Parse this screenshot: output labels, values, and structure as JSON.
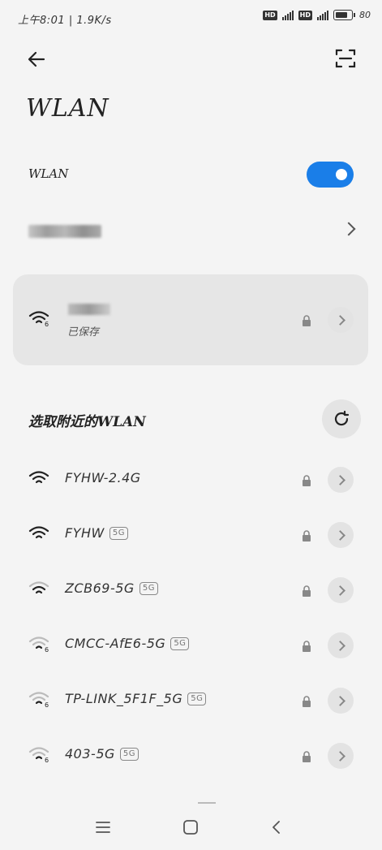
{
  "status_bar": {
    "time_speed": "上午8:01 | 1.9K/s",
    "battery": "80"
  },
  "header": {
    "title": "WLAN"
  },
  "wlan_toggle": {
    "label": "WLAN",
    "on": true
  },
  "saved_network": {
    "status": "已保存"
  },
  "nearby": {
    "title": "选取附近的WLAN",
    "networks": [
      {
        "ssid": "FYHW-2.4G",
        "badge": ""
      },
      {
        "ssid": "FYHW",
        "badge": "5G"
      },
      {
        "ssid": "ZCB69-5G",
        "badge": "5G"
      },
      {
        "ssid": "CMCC-AfE6-5G",
        "badge": "5G"
      },
      {
        "ssid": "TP-LINK_5F1F_5G",
        "badge": "5G"
      },
      {
        "ssid": "403-5G",
        "badge": "5G"
      }
    ]
  },
  "icons": [
    "back-icon",
    "scan-icon",
    "wifi-icon",
    "lock-icon",
    "refresh-icon",
    "menu-icon",
    "home-icon",
    "back-nav-icon"
  ]
}
